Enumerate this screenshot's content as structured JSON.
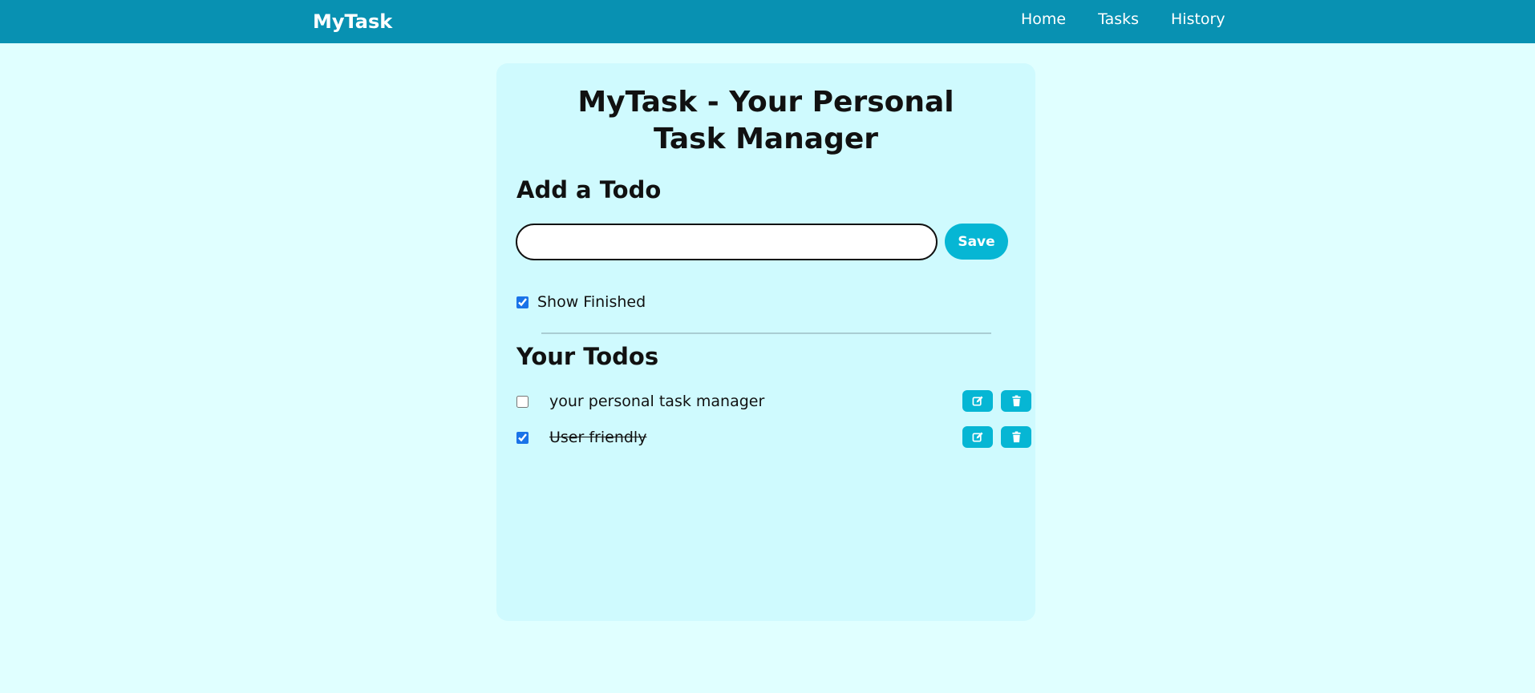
{
  "navbar": {
    "brand": "MyTask",
    "links": [
      "Home",
      "Tasks",
      "History"
    ]
  },
  "main": {
    "title": "MyTask - Your Personal Task Manager",
    "add_heading": "Add a Todo",
    "input": {
      "value": "",
      "placeholder": ""
    },
    "save_label": "Save",
    "show_finished": {
      "label": "Show Finished",
      "checked": true
    },
    "todos_heading": "Your Todos",
    "todos": [
      {
        "text": "your personal task manager",
        "completed": false
      },
      {
        "text": "User friendly",
        "completed": true
      }
    ]
  },
  "colors": {
    "navbar": "#0891b2",
    "page_background": "#e0ffff",
    "card_background": "#cffafe",
    "accent": "#06b6d4"
  },
  "icons": [
    "edit-icon",
    "trash-icon"
  ]
}
